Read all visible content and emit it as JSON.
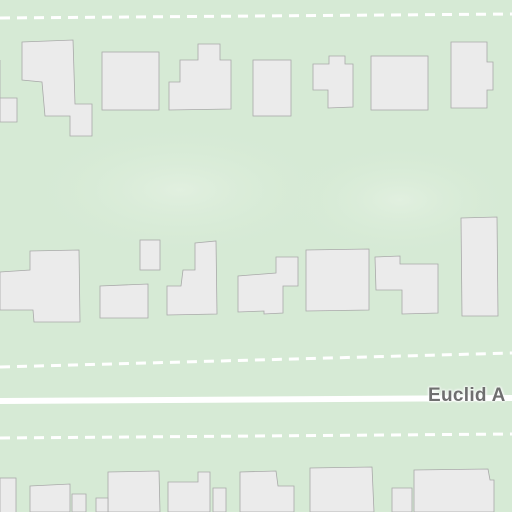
{
  "map": {
    "background_color": "#d6ead5",
    "building_color": "#ebebeb",
    "road_color": "#ffffff",
    "labels": {
      "street": "Euclid A"
    }
  }
}
